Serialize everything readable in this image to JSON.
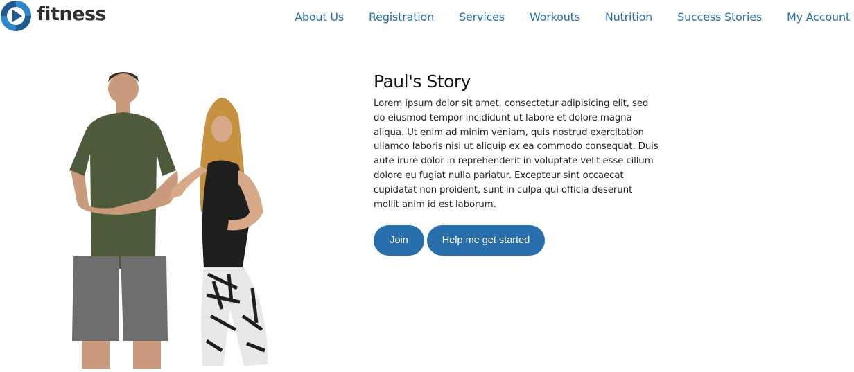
{
  "brand": {
    "name": "fitness",
    "logo_icon": "play-circle-logo-icon",
    "accent": "#2870ad"
  },
  "nav": {
    "items": [
      {
        "label": "About Us"
      },
      {
        "label": "Registration"
      },
      {
        "label": "Services"
      },
      {
        "label": "Workouts"
      },
      {
        "label": "Nutrition"
      },
      {
        "label": "Success Stories"
      },
      {
        "label": "My Account"
      }
    ]
  },
  "story": {
    "title": "Paul's Story",
    "body": "Lorem ipsum dolor sit amet, consectetur adipisicing elit, sed do eiusmod tempor incididunt ut labore et dolore magna aliqua. Ut enim ad minim veniam, quis nostrud exercitation ullamco laboris nisi ut aliquip ex ea commodo consequat. Duis aute irure dolor in reprehenderit in voluptate velit esse cillum dolore eu fugiat nulla pariatur. Excepteur sint occaecat cupidatat non proident, sunt in culpa qui officia deserunt mollit anim id est laborum."
  },
  "actions": {
    "join_label": "Join",
    "start_label": "Help me get started"
  }
}
